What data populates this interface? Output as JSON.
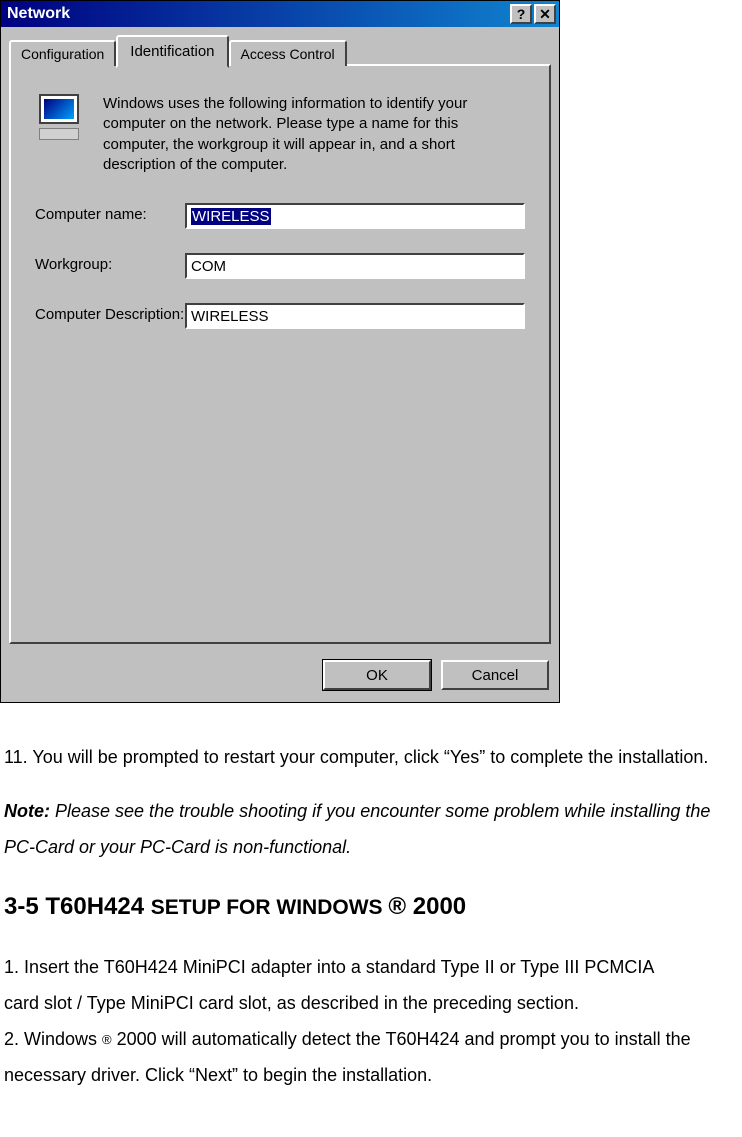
{
  "dialog": {
    "title": "Network",
    "tabs": {
      "configuration": "Configuration",
      "identification": "Identification",
      "access_control": "Access Control"
    },
    "description": "Windows uses the following information to identify your computer on the network. Please type a name for this computer, the workgroup it will appear in, and a short description of the computer.",
    "labels": {
      "computer_name": "Computer name:",
      "workgroup": "Workgroup:",
      "computer_description": "Computer Description:"
    },
    "values": {
      "computer_name": "WIRELESS",
      "workgroup": "COM",
      "computer_description": "WIRELESS"
    },
    "buttons": {
      "ok": "OK",
      "cancel": "Cancel"
    }
  },
  "doc": {
    "step11": "11. You will be prompted to restart your computer, click “Yes” to complete the installation.",
    "note_label": "Note:",
    "note_text": " Please see the trouble shooting if you encounter some problem while installing the PC-Card or your PC-Card is non-functional.",
    "heading_prefix": "3-5 T60H424 ",
    "heading_caps": "SETUP FOR WINDOWS ",
    "heading_reg": "®",
    "heading_suffix": " 2000",
    "step1a": "1. Insert the T60H424 MiniPCI adapter into a standard Type II or Type III PCMCIA",
    "step1b": "card slot / Type MiniPCI card slot, as described in the preceding section.",
    "step2a_pre": "2. Windows ",
    "step2a_reg": "®",
    "step2a_post": " 2000 will automatically detect the T60H424 and prompt you to install the",
    "step2b": "necessary driver. Click “Next” to begin the installation."
  }
}
